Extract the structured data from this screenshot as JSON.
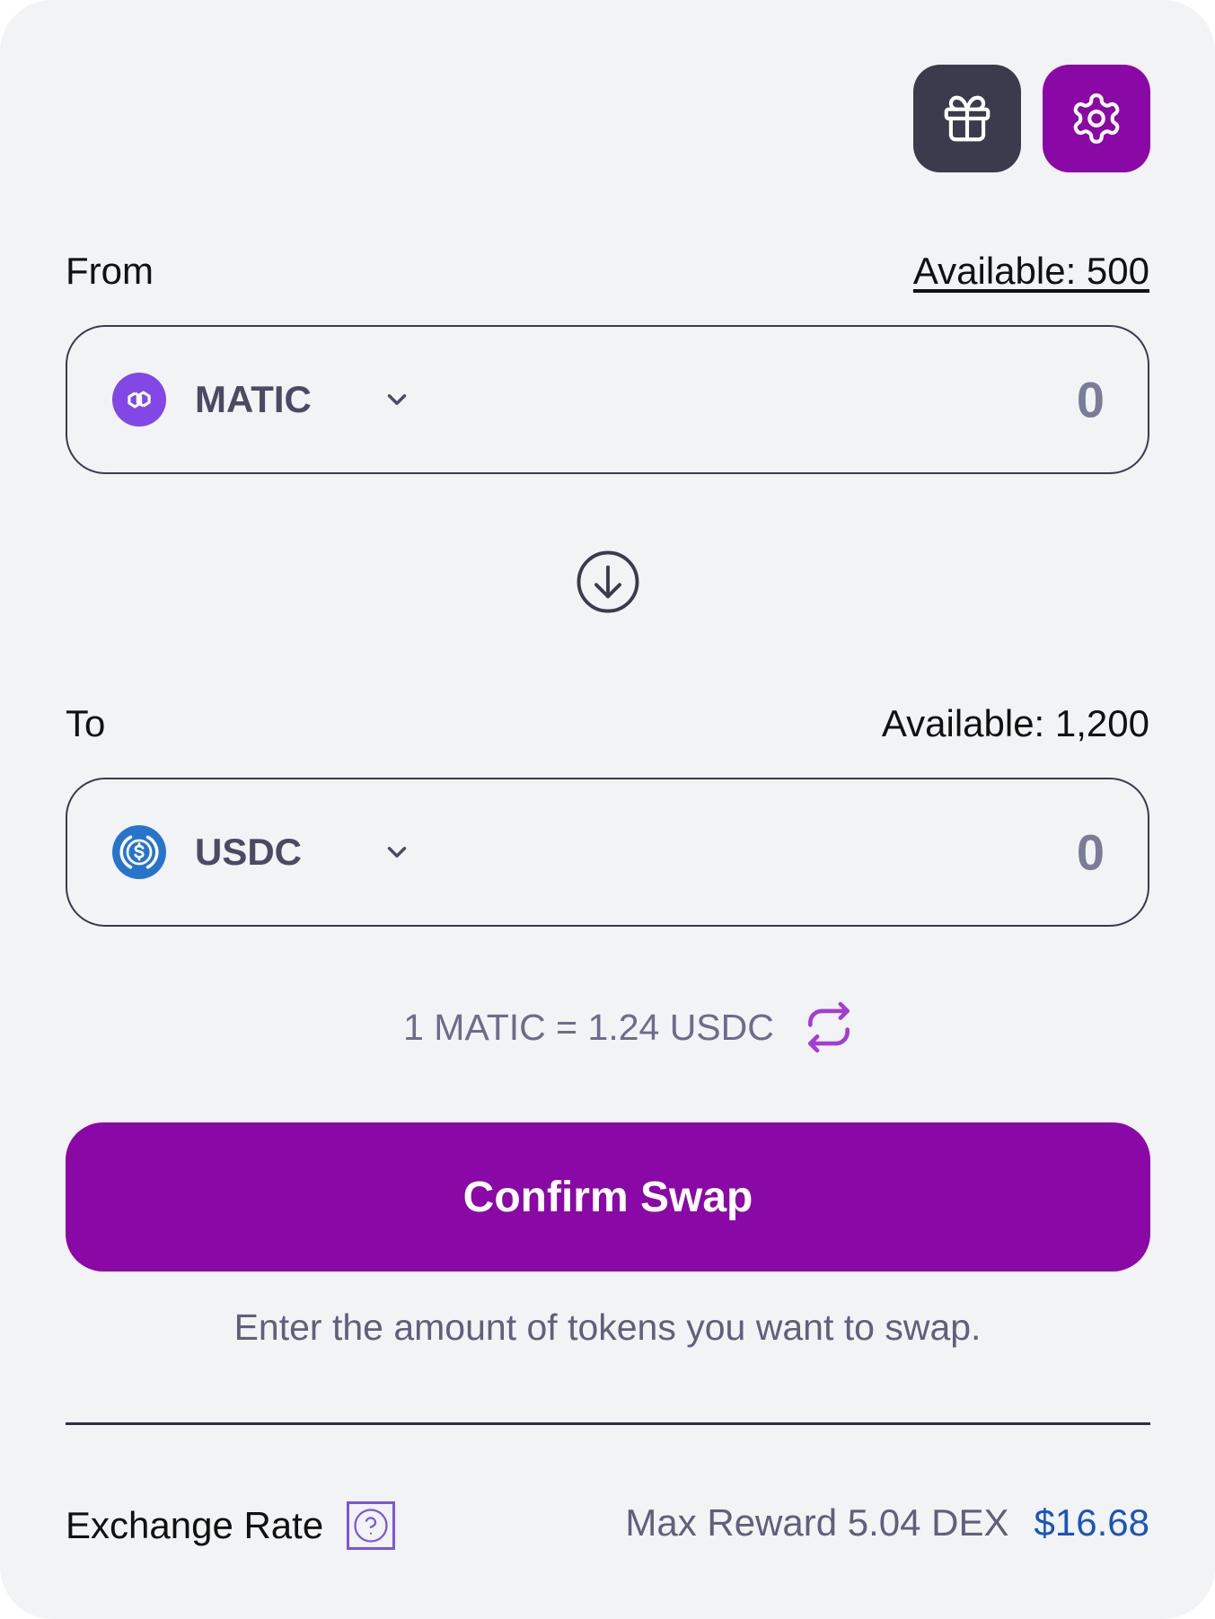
{
  "header": {
    "gift_icon": "gift-icon",
    "settings_icon": "gear-icon"
  },
  "from": {
    "label": "From",
    "available": "Available: 500",
    "token_symbol": "MATIC",
    "token_icon": "polygon-logo-icon",
    "amount_placeholder": "0"
  },
  "direction_icon": "arrow-down-circle-icon",
  "to": {
    "label": "To",
    "available": "Available: 1,200",
    "token_symbol": "USDC",
    "token_icon": "usdc-logo-icon",
    "amount_placeholder": "0"
  },
  "rate": {
    "text": "1 MATIC = 1.24 USDC",
    "refresh_icon": "refresh-icon"
  },
  "confirm_label": "Confirm Swap",
  "helper_text": "Enter the amount of tokens you want to swap.",
  "footer": {
    "label": "Exchange Rate",
    "help_icon": "question-icon",
    "reward_text": "Max Reward 5.04 DEX",
    "reward_value": "$16.68"
  },
  "colors": {
    "accent": "#8a08a6",
    "dark_button": "#3a3b4c",
    "background": "#f2f3f5",
    "matic": "#8247e5",
    "usdc": "#2775ca",
    "link_blue": "#1a55b8"
  }
}
